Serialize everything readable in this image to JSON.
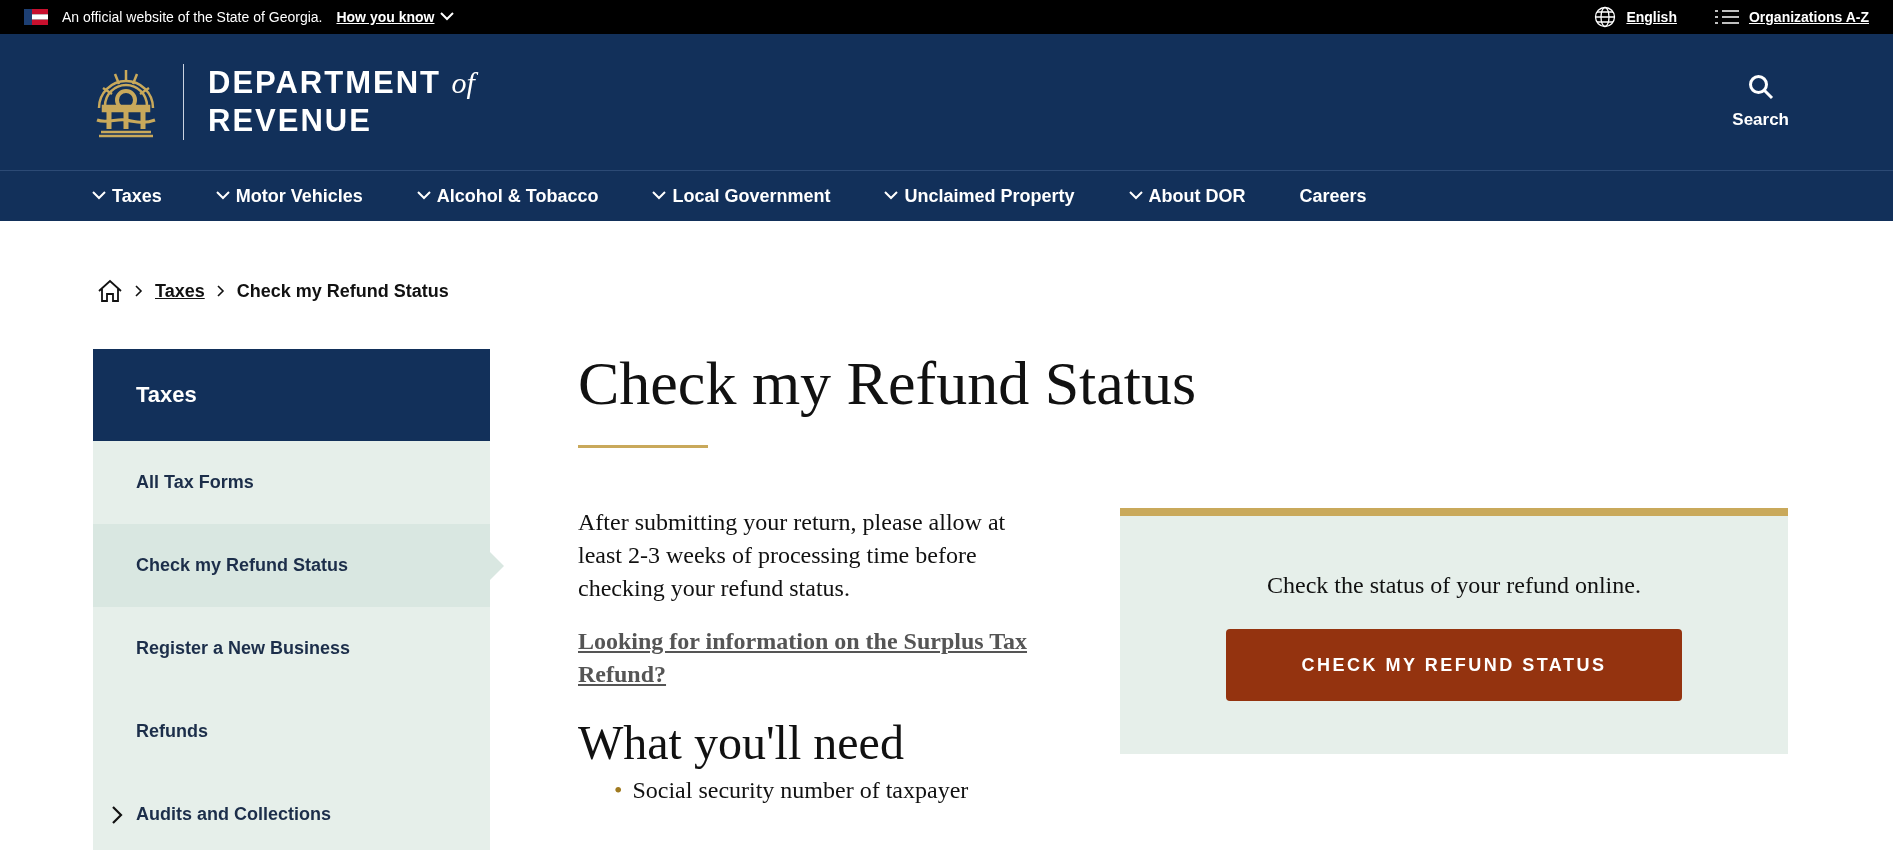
{
  "official_banner": {
    "text": "An official website of the State of Georgia.",
    "link": "How you know",
    "language": "English",
    "organizations": "Organizations A-Z"
  },
  "header": {
    "title_line1": "DEPARTMENT",
    "title_of": "of",
    "title_line2": "REVENUE",
    "search_label": "Search"
  },
  "nav": [
    {
      "label": "Taxes",
      "kind": "menu"
    },
    {
      "label": "Motor Vehicles",
      "kind": "menu"
    },
    {
      "label": "Alcohol & Tobacco",
      "kind": "menu"
    },
    {
      "label": "Local Government",
      "kind": "menu"
    },
    {
      "label": "Unclaimed Property",
      "kind": "menu"
    },
    {
      "label": "About DOR",
      "kind": "menu"
    },
    {
      "label": "Careers",
      "kind": "link"
    }
  ],
  "breadcrumb": [
    {
      "label": "Taxes",
      "kind": "link"
    },
    {
      "label": "Check my Refund Status",
      "kind": "current"
    }
  ],
  "sidebar": {
    "title": "Taxes",
    "items": [
      {
        "label": "All Tax Forms",
        "kind": "link",
        "selected": false
      },
      {
        "label": "Check my Refund Status",
        "kind": "link",
        "selected": true
      },
      {
        "label": "Register a New Business",
        "kind": "link",
        "selected": false
      },
      {
        "label": "Refunds",
        "kind": "link",
        "selected": false
      },
      {
        "label": "Audits and Collections",
        "kind": "group",
        "selected": false
      }
    ]
  },
  "main": {
    "title": "Check my Refund Status",
    "intro": "After submitting your return, please allow at least 2-3 weeks of processing time before checking your refund status.",
    "surplus_link": "Looking for information on the Surplus Tax Refund?",
    "needs_heading": "What you'll need",
    "needs": [
      {
        "marker": "•",
        "text": "Social security number of taxpayer"
      }
    ]
  },
  "callout": {
    "text": "Check the status of your refund online.",
    "button": "CHECK MY REFUND STATUS"
  }
}
